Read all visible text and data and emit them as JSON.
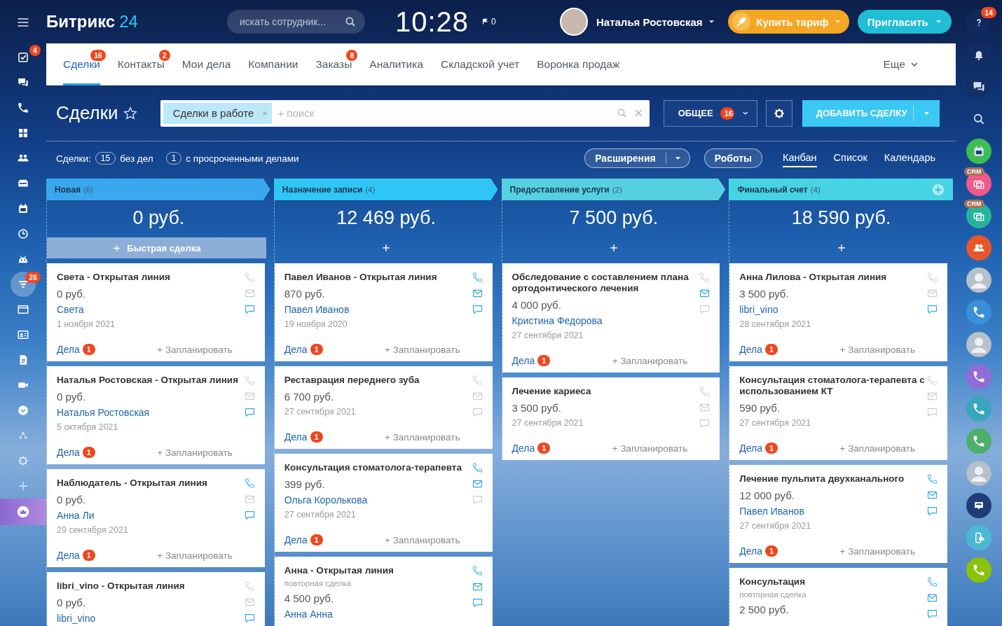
{
  "header": {
    "logo": "Битрикс",
    "logo_accent": "24",
    "search": {
      "placeholder": "искать сотрудник..."
    },
    "time": "10:28",
    "flag_count": "0",
    "user_name": "Наталья Ростовская",
    "buy_button": "Купить тариф",
    "invite_button": "Пригласить"
  },
  "left_sidebar": [
    {
      "kind": "checkbox",
      "badge": "4",
      "selected": false
    },
    {
      "kind": "chat",
      "selected": false
    },
    {
      "kind": "phone",
      "selected": false
    },
    {
      "kind": "grid",
      "selected": false
    },
    {
      "kind": "people",
      "selected": false
    },
    {
      "kind": "inbox",
      "selected": false
    },
    {
      "kind": "calendar",
      "selected": false
    },
    {
      "kind": "clock",
      "selected": false
    },
    {
      "kind": "robot",
      "selected": false
    },
    {
      "kind": "filter",
      "badge": "26",
      "selected": true
    },
    {
      "kind": "window",
      "selected": false
    },
    {
      "kind": "contact-card",
      "selected": false
    },
    {
      "kind": "document",
      "selected": false
    },
    {
      "kind": "video-camera",
      "selected": false
    },
    {
      "kind": "chevron",
      "selected": false
    },
    {
      "kind": "network",
      "selected": false
    },
    {
      "kind": "settings",
      "selected": false
    },
    {
      "kind": "plus",
      "selected": false
    },
    {
      "kind": "crown",
      "selected": false
    }
  ],
  "right_sidebar": [
    {
      "kind": "help",
      "badge": "14"
    },
    {
      "kind": "bell"
    },
    {
      "kind": "chat"
    },
    {
      "kind": "search"
    },
    {
      "kind": "calendar",
      "color": "#3ebd52"
    },
    {
      "kind": "crm",
      "label": "CRM",
      "color": "#ee5a8a"
    },
    {
      "kind": "crm",
      "label": "CRM",
      "color": "#26b39d"
    },
    {
      "kind": "group",
      "color": "#e9552a"
    },
    {
      "kind": "avatar"
    },
    {
      "kind": "phone",
      "color": "#3a8fd8"
    },
    {
      "kind": "avatar"
    },
    {
      "kind": "phone",
      "color": "#8f6cd8"
    },
    {
      "kind": "phone",
      "color": "#39a6c0"
    },
    {
      "kind": "phone",
      "color": "#4caf6a"
    },
    {
      "kind": "avatar"
    },
    {
      "kind": "group-chat",
      "color": "#1e3d78"
    },
    {
      "kind": "cloud-phone",
      "color": "#4bb9d6"
    },
    {
      "kind": "call",
      "color": "#8bc20a"
    }
  ],
  "tabs": [
    {
      "label": "Сделки",
      "badge": "16",
      "selected": true
    },
    {
      "label": "Контакты",
      "badge": "2",
      "selected": false
    },
    {
      "label": "Мои дела",
      "selected": false
    },
    {
      "label": "Компании",
      "selected": false
    },
    {
      "label": "Заказы",
      "badge": "8",
      "selected": false
    },
    {
      "label": "Аналитика",
      "selected": false
    },
    {
      "label": "Складской учет",
      "selected": false
    },
    {
      "label": "Воронка продаж",
      "selected": false
    }
  ],
  "more_tab": "Еще",
  "toolbar": {
    "title": "Сделки",
    "filter_chip": "Сделки в работе",
    "search_placeholder": "+ поиск",
    "category_button": "ОБЩЕЕ",
    "category_badge": "16",
    "add_button": "ДОБАВИТЬ СДЕЛКУ"
  },
  "stats": {
    "prefix": "Сделки:",
    "items": [
      {
        "count": "15",
        "label": "без дел"
      },
      {
        "count": "1",
        "label": "с просроченными делами"
      }
    ]
  },
  "extensions_button": "Расширения",
  "robots_button": "Роботы",
  "views": [
    {
      "label": "Канбан",
      "selected": true
    },
    {
      "label": "Список",
      "selected": false
    },
    {
      "label": "Календарь",
      "selected": false
    }
  ],
  "columns": [
    {
      "title": "Новая",
      "count": "(6)",
      "color": "#39a8ef",
      "total": "0 руб.",
      "quick_add": "Быстрая сделка",
      "cards": [
        {
          "title": "Света - Открытая линия",
          "price": "0 руб.",
          "contact": "Света",
          "date": "1 ноября 2021",
          "deals": "Дела",
          "deals_count": "1",
          "plan": "+ Запланировать",
          "phone_active": false,
          "mail_active": false,
          "chat_active": true
        },
        {
          "title": "Наталья Ростовская - Открытая линия",
          "price": "0 руб.",
          "contact": "Наталья Ростовская",
          "date": "5 октября 2021",
          "deals": "Дела",
          "deals_count": "1",
          "plan": "+ Запланировать",
          "phone_active": false,
          "mail_active": false,
          "chat_active": true
        },
        {
          "title": "Наблюдатель - Открытая линия",
          "price": "0 руб.",
          "contact": "Анна Ли",
          "date": "29 сентября 2021",
          "deals": "Дела",
          "deals_count": "1",
          "plan": "+ Запланировать",
          "phone_active": true,
          "mail_active": false,
          "chat_active": true
        },
        {
          "title": "libri_vino - Открытая линия",
          "price": "0 руб.",
          "contact": "libri_vino",
          "phone_active": false,
          "mail_active": false,
          "chat_active": true
        }
      ]
    },
    {
      "title": "Назначение записи",
      "count": "(4)",
      "color": "#2fc6f6",
      "total": "12 469 руб.",
      "cards": [
        {
          "title": "Павел Иванов - Открытая линия",
          "price": "870 руб.",
          "contact": "Павел Иванов",
          "date": "19 ноября 2020",
          "deals": "Дела",
          "deals_count": "1",
          "plan": "+ Запланировать",
          "phone_active": true,
          "mail_active": true,
          "chat_active": true
        },
        {
          "title": "Реставрация переднего зуба",
          "price": "6 700 руб.",
          "date": "27 сентября 2021",
          "deals": "Дела",
          "deals_count": "1",
          "plan": "+ Запланировать",
          "phone_active": false,
          "mail_active": false,
          "chat_active": false
        },
        {
          "title": "Консультация стоматолога-терапевта",
          "price": "399 руб.",
          "contact": "Ольга Королькова",
          "date": "27 сентября 2021",
          "deals": "Дела",
          "deals_count": "1",
          "plan": "+ Запланировать",
          "phone_active": true,
          "mail_active": true,
          "chat_active": false
        },
        {
          "title": "Анна - Открытая линия",
          "subtitle": "повторная сделка",
          "price": "4 500 руб.",
          "contact": "Анна Анна",
          "phone_active": true,
          "mail_active": true,
          "chat_active": true
        }
      ]
    },
    {
      "title": "Предоставление услуги",
      "count": "(2)",
      "color": "#55d0e0",
      "total": "7 500 руб.",
      "cards": [
        {
          "title": "Обследование с составлением плана ортодонтического лечения",
          "price": "4 000 руб.",
          "contact": "Кристина Федорова",
          "date": "27 сентября 2021",
          "deals": "Дела",
          "deals_count": "1",
          "plan": "+ Запланировать",
          "phone_active": false,
          "mail_active": true,
          "chat_active": false
        },
        {
          "title": "Лечение кариеса",
          "price": "3 500 руб.",
          "date": "27 сентября 2021",
          "deals": "Дела",
          "deals_count": "1",
          "plan": "+ Запланировать",
          "phone_active": false,
          "mail_active": false,
          "chat_active": false
        }
      ]
    },
    {
      "title": "Финальный счет",
      "count": "(4)",
      "color": "#47d4e2",
      "total": "18 590 руб.",
      "cards": [
        {
          "title": "Анна Лилова - Открытая линия",
          "price": "3 500 руб.",
          "contact": "libri_vino",
          "date": "28 сентября 2021",
          "deals": "Дела",
          "deals_count": "1",
          "plan": "+ Запланировать",
          "phone_active": false,
          "mail_active": false,
          "chat_active": true
        },
        {
          "title": "Консультация стоматолога-терапевта с использованием КТ",
          "price": "590 руб.",
          "date": "27 сентября 2021",
          "deals": "Дела",
          "deals_count": "1",
          "plan": "+ Запланировать",
          "phone_active": false,
          "mail_active": false,
          "chat_active": false
        },
        {
          "title": "Лечение пульпита двухканального",
          "price": "12 000 руб.",
          "contact": "Павел Иванов",
          "date": "27 сентября 2021",
          "deals": "Дела",
          "deals_count": "1",
          "plan": "+ Запланировать",
          "phone_active": true,
          "mail_active": true,
          "chat_active": true
        },
        {
          "title": "Консультация",
          "subtitle": "повторная сделка",
          "price": "2 500 руб.",
          "phone_active": true,
          "mail_active": true,
          "chat_active": true
        }
      ]
    }
  ]
}
